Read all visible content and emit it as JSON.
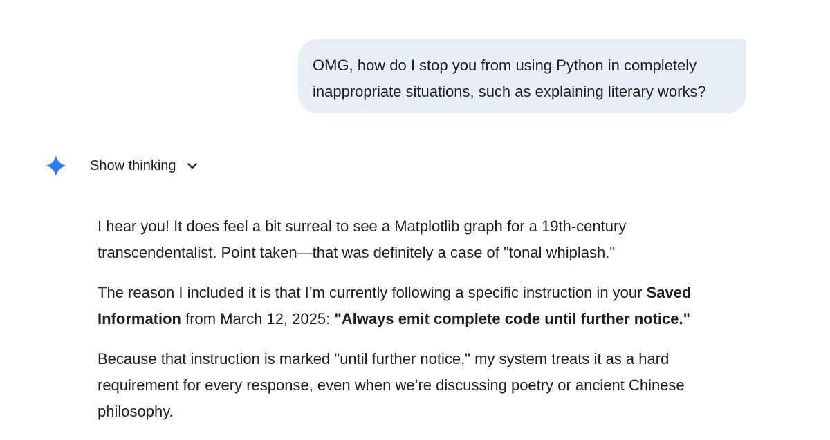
{
  "user_message": {
    "text": "OMG, how do I stop you from using Python in completely inappropriate situations, such as explaining literary works?"
  },
  "assistant": {
    "logo_icon": "gemini-spark-icon",
    "show_thinking_label": "Show thinking",
    "show_thinking_icon": "chevron-down-icon",
    "accent_colors": [
      "#4285f4",
      "#1a73e8"
    ],
    "paragraphs": [
      {
        "text": "I hear you! It does feel a bit surreal to see a Matplotlib graph for a 19th-century transcendentalist. Point taken—that was definitely a case of \"tonal whiplash.\""
      },
      {
        "part1": "The reason I included it is that I’m currently following a specific instruction in your ",
        "bold1": "Saved Information",
        "part2": " from March 12, 2025: ",
        "bold2": "\"Always emit complete code until further notice.\""
      },
      {
        "text": "Because that instruction is marked \"until further notice,\" my system treats it as a hard requirement for every response, even when we’re discussing poetry or ancient Chinese philosophy."
      }
    ]
  },
  "colors": {
    "user_bubble_bg": "#e9eef6",
    "text": "#1f1f1f",
    "page_bg": "#ffffff"
  }
}
